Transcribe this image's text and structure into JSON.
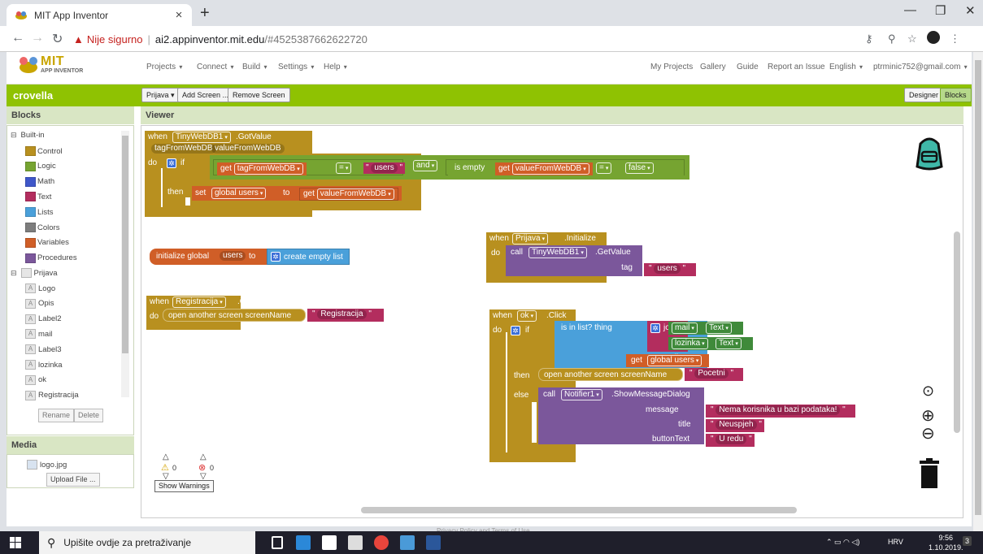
{
  "browser": {
    "tab_title": "MIT App Inventor",
    "new_tab": "+",
    "not_secure": "Nije sigurno",
    "url_host": "ai2.appinventor.mit.edu",
    "url_path": "/#4525387662622720"
  },
  "header": {
    "logo_text": "MIT",
    "logo_sub": "APP INVENTOR",
    "menus": [
      "Projects",
      "Connect",
      "Build",
      "Settings",
      "Help"
    ],
    "right_links": [
      "My Projects",
      "Gallery",
      "Guide",
      "Report an Issue",
      "English",
      "ptrminic752@gmail.com"
    ]
  },
  "greenbar": {
    "project": "crovella",
    "screen_select": "Prijava",
    "add_screen": "Add Screen ...",
    "remove_screen": "Remove Screen",
    "designer": "Designer",
    "blocks": "Blocks"
  },
  "blocks_panel": {
    "title": "Blocks",
    "builtin_label": "Built-in",
    "builtin": [
      {
        "label": "Control",
        "color": "#b8901f"
      },
      {
        "label": "Logic",
        "color": "#76a431"
      },
      {
        "label": "Math",
        "color": "#3f57c9"
      },
      {
        "label": "Text",
        "color": "#b32d5e"
      },
      {
        "label": "Lists",
        "color": "#4aa0da"
      },
      {
        "label": "Colors",
        "color": "#7d7d7d"
      },
      {
        "label": "Variables",
        "color": "#d05e27"
      },
      {
        "label": "Procedures",
        "color": "#7b579b"
      }
    ],
    "screen_label": "Prijava",
    "components": [
      "Logo",
      "Opis",
      "Label2",
      "mail",
      "Label3",
      "lozinka",
      "ok",
      "Registracija"
    ],
    "rename": "Rename",
    "delete": "Delete"
  },
  "media_panel": {
    "title": "Media",
    "file": "logo.jpg",
    "upload": "Upload File ..."
  },
  "viewer": {
    "title": "Viewer",
    "block1": {
      "when": "when",
      "component": "TinyWebDB1",
      "event": ".GotValue",
      "param1": "tagFromWebDB",
      "param2": "valueFromWebDB",
      "do": "do",
      "if": "if",
      "get": "get",
      "var_tag": "tagFromWebDB",
      "eq": "=",
      "users": "users",
      "and": "and",
      "is_empty": "is empty",
      "var_value": "valueFromWebDB",
      "false": "false",
      "then": "then",
      "set": "set",
      "global_users": "global users",
      "to": "to"
    },
    "block2": {
      "init": "initialize global",
      "name": "users",
      "to": "to",
      "create": "create empty list"
    },
    "block3": {
      "when": "when",
      "component": "Registracija",
      "event": ".Click",
      "do": "do",
      "open": "open another screen  screenName",
      "value": "Registracija"
    },
    "block4": {
      "when": "when",
      "component": "Prijava",
      "event": ".Initialize",
      "do": "do",
      "call": "call",
      "target": "TinyWebDB1",
      "method": ".GetValue",
      "tag": "tag",
      "tag_value": "users"
    },
    "block5": {
      "when": "when",
      "component": "ok",
      "event": ".Click",
      "do": "do",
      "if": "if",
      "is_in_list": "is in list?  thing",
      "join": "join",
      "mail": "mail",
      "text": "Text",
      "lozinka": "lozinka",
      "list": "list",
      "get": "get",
      "global_users": "global users",
      "then": "then",
      "open": "open another screen  screenName",
      "pocetni": "Pocetni",
      "else": "else",
      "call": "call",
      "notifier": "Notifier1",
      "method": ".ShowMessageDialog",
      "message": "message",
      "message_value": "Nema korisnika u bazi podataka!",
      "title_label": "title",
      "title_value": "Neuspjeh",
      "button_label": "buttonText",
      "button_value": "U redu"
    },
    "warnings_count": "0",
    "errors_count": "0",
    "show_warnings": "Show Warnings"
  },
  "footer": {
    "privacy": "Privacy Policy and Terms of Use"
  },
  "taskbar": {
    "search": "Upišite ovdje za pretraživanje",
    "lang": "HRV",
    "time": "9:56",
    "date": "1.10.2019.",
    "notif": "3"
  }
}
